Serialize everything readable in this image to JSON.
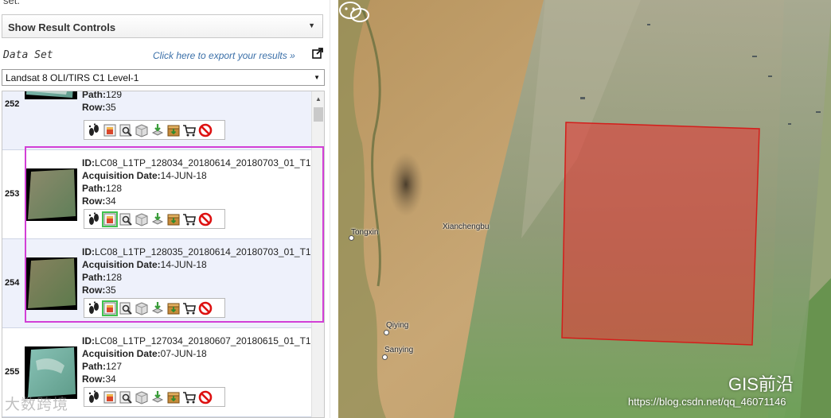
{
  "header": {
    "fragment_text": "set."
  },
  "results_controls": {
    "label": "Show Result Controls"
  },
  "dataset": {
    "label": "Data Set",
    "export_link": "Click here to export your results »",
    "selected": "Landsat 8 OLI/TIRS C1 Level-1"
  },
  "field_labels": {
    "id": "ID:",
    "date": "Acquisition Date:",
    "path": "Path:",
    "row": "Row:"
  },
  "results": [
    {
      "num": "252",
      "id": "",
      "date": "",
      "path": "129",
      "row": "35"
    },
    {
      "num": "253",
      "id": "LC08_L1TP_128034_20180614_20180703_01_T1",
      "date": "14-JUN-18",
      "path": "128",
      "row": "34"
    },
    {
      "num": "254",
      "id": "LC08_L1TP_128035_20180614_20180703_01_T1",
      "date": "14-JUN-18",
      "path": "128",
      "row": "35"
    },
    {
      "num": "255",
      "id": "LC08_L1TP_127034_20180607_20180615_01_T1",
      "date": "07-JUN-18",
      "path": "127",
      "row": "34"
    }
  ],
  "toolbar_icons": [
    "footprint-icon",
    "overlay-icon",
    "metadata-icon",
    "compare-icon",
    "download-icon",
    "bulk-download-icon",
    "cart-icon",
    "exclude-icon"
  ],
  "highlight_color": "#d23fd6",
  "map": {
    "places": [
      "Tongxin",
      "Xianchengbu",
      "Qiying",
      "Sanying"
    ],
    "footprint_color": "#e8322f"
  },
  "watermarks": {
    "left": "大数跨境",
    "brand": "GIS前沿",
    "url": "https://blog.csdn.net/qq_46071146"
  }
}
